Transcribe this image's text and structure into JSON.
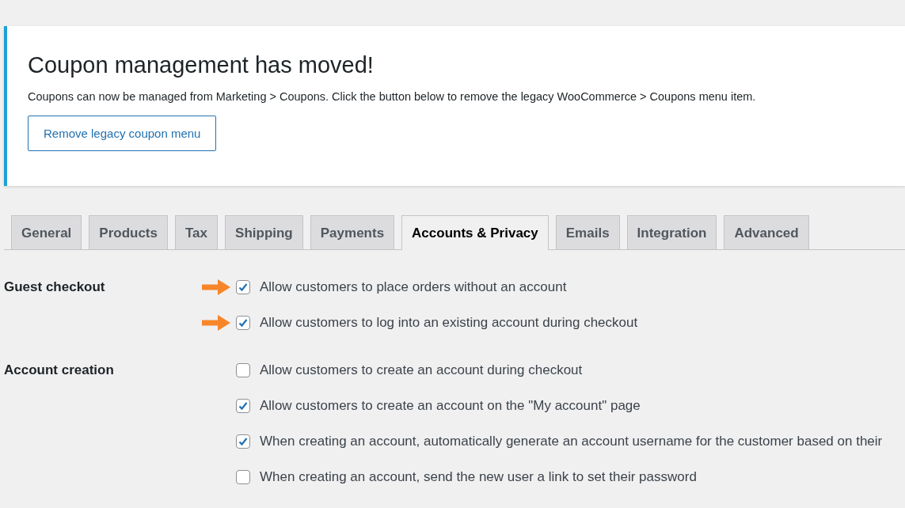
{
  "notice": {
    "title": "Coupon management has moved!",
    "text": "Coupons can now be managed from Marketing > Coupons. Click the button below to remove the legacy WooCommerce > Coupons menu item.",
    "button": "Remove legacy coupon menu"
  },
  "tabs": [
    {
      "label": "General",
      "selected": false
    },
    {
      "label": "Products",
      "selected": false
    },
    {
      "label": "Tax",
      "selected": false
    },
    {
      "label": "Shipping",
      "selected": false
    },
    {
      "label": "Payments",
      "selected": false
    },
    {
      "label": "Accounts & Privacy",
      "selected": true
    },
    {
      "label": "Emails",
      "selected": false
    },
    {
      "label": "Integration",
      "selected": false
    },
    {
      "label": "Advanced",
      "selected": false
    }
  ],
  "sections": [
    {
      "label": "Guest checkout",
      "options": [
        {
          "label": "Allow customers to place orders without an account",
          "checked": true,
          "arrow": true
        },
        {
          "label": "Allow customers to log into an existing account during checkout",
          "checked": true,
          "arrow": true
        }
      ]
    },
    {
      "label": "Account creation",
      "options": [
        {
          "label": "Allow customers to create an account during checkout",
          "checked": false,
          "arrow": false
        },
        {
          "label": "Allow customers to create an account on the \"My account\" page",
          "checked": true,
          "arrow": false
        },
        {
          "label": "When creating an account, automatically generate an account username for the customer based on their",
          "checked": true,
          "arrow": false
        },
        {
          "label": "When creating an account, send the new user a link to set their password",
          "checked": false,
          "arrow": false
        }
      ]
    }
  ]
}
